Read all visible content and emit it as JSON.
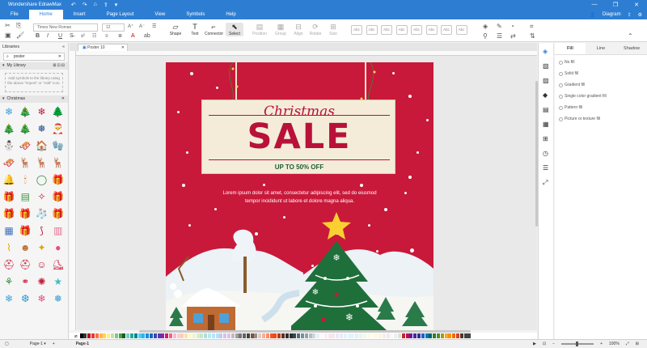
{
  "app": {
    "title": "Wondershare EdrawMax",
    "user_label": "Diagram",
    "window_controls": [
      "—",
      "❐",
      "✕"
    ]
  },
  "quick_access": [
    "↶",
    "↷",
    "⌂",
    "⇪",
    "▾"
  ],
  "tabs": [
    "File",
    "Home",
    "Insert",
    "Page Layout",
    "View",
    "Symbols",
    "Help"
  ],
  "active_tab": "Home",
  "ribbon": {
    "font_name": "Times New Roman",
    "font_size": "12",
    "tools": [
      {
        "label": "Shape",
        "icon": "▱",
        "state": "normal"
      },
      {
        "label": "Text",
        "icon": "T",
        "state": "normal"
      },
      {
        "label": "Connector",
        "icon": "⌐",
        "state": "normal"
      },
      {
        "label": "Select",
        "icon": "⬉",
        "state": "selected"
      },
      {
        "label": "Position",
        "icon": "▤",
        "state": "dim"
      },
      {
        "label": "Group",
        "icon": "▦",
        "state": "dim"
      },
      {
        "label": "Align",
        "icon": "⊟",
        "state": "dim"
      },
      {
        "label": "Rotate",
        "icon": "⟳",
        "state": "dim"
      },
      {
        "label": "Size",
        "icon": "⊞",
        "state": "dim"
      }
    ],
    "style_boxes": [
      "Abc",
      "Abc",
      "Abc",
      "Abc",
      "Abc",
      "Abc",
      "Abc",
      "Abc"
    ]
  },
  "library": {
    "title": "Libraries",
    "search_value": "poster",
    "my_library": "My Library",
    "add_hint": "Add symbols to the library using the above \"Import\" or \"Add\" icon.",
    "category": "Christmas"
  },
  "symbols": [
    {
      "name": "snowflake-blue",
      "glyph": "❄",
      "color": "#3ba0d8"
    },
    {
      "name": "tree-green",
      "glyph": "🎄",
      "color": "#2e8b3a"
    },
    {
      "name": "snowflake-red",
      "glyph": "❄",
      "color": "#c8193a"
    },
    {
      "name": "tree-dark",
      "glyph": "🌲",
      "color": "#1f6f4a"
    },
    {
      "name": "tree-teal",
      "glyph": "🎄",
      "color": "#2a9d8f"
    },
    {
      "name": "tree-lime",
      "glyph": "🎄",
      "color": "#3a9a3a"
    },
    {
      "name": "snowflake-navy",
      "glyph": "❅",
      "color": "#2f4f8f"
    },
    {
      "name": "santa",
      "glyph": "🎅",
      "color": "#c8193a"
    },
    {
      "name": "snowman",
      "glyph": "⛄",
      "color": "#555"
    },
    {
      "name": "sled",
      "glyph": "🛷",
      "color": "#c8193a"
    },
    {
      "name": "cabin",
      "glyph": "🏠",
      "color": "#b5651d"
    },
    {
      "name": "mitten",
      "glyph": "🧤",
      "color": "#3ba0d8"
    },
    {
      "name": "sleigh",
      "glyph": "🛷",
      "color": "#c8193a"
    },
    {
      "name": "reindeer-team",
      "glyph": "🦌",
      "color": "#a0522d"
    },
    {
      "name": "reindeer",
      "glyph": "🦌",
      "color": "#8b5a2b"
    },
    {
      "name": "deer",
      "glyph": "🦌",
      "color": "#a0522d"
    },
    {
      "name": "bells",
      "glyph": "🔔",
      "color": "#e0a800"
    },
    {
      "name": "candle",
      "glyph": "🕯",
      "color": "#e07020"
    },
    {
      "name": "wreath",
      "glyph": "◯",
      "color": "#2e8b3a"
    },
    {
      "name": "gift-stack",
      "glyph": "🎁",
      "color": "#d04040"
    },
    {
      "name": "gift-teal",
      "glyph": "🎁",
      "color": "#2a9d8f"
    },
    {
      "name": "card-green",
      "glyph": "▤",
      "color": "#3a9a3a"
    },
    {
      "name": "ornament",
      "glyph": "✧",
      "color": "#c8193a"
    },
    {
      "name": "gift-purple",
      "glyph": "🎁",
      "color": "#5b5bd6"
    },
    {
      "name": "gift-red",
      "glyph": "🎁",
      "color": "#c8193a"
    },
    {
      "name": "gift-blue",
      "glyph": "🎁",
      "color": "#3ba0d8"
    },
    {
      "name": "stocking",
      "glyph": "🧦",
      "color": "#c8193a"
    },
    {
      "name": "gift-pink",
      "glyph": "🎁",
      "color": "#e05080"
    },
    {
      "name": "pattern-blue",
      "glyph": "▦",
      "color": "#3b6fb8"
    },
    {
      "name": "gift-aqua",
      "glyph": "🎁",
      "color": "#3ac0c8"
    },
    {
      "name": "candy-cane",
      "glyph": "⟆",
      "color": "#c8193a"
    },
    {
      "name": "sweater",
      "glyph": "▥",
      "color": "#e07090"
    },
    {
      "name": "candy",
      "glyph": "⌇",
      "color": "#e0a800"
    },
    {
      "name": "gingerbread",
      "glyph": "☻",
      "color": "#c07030"
    },
    {
      "name": "ornament-gold",
      "glyph": "✦",
      "color": "#e0a800"
    },
    {
      "name": "bauble-pink",
      "glyph": "●",
      "color": "#e05080"
    },
    {
      "name": "santa-hat",
      "glyph": "⛑",
      "color": "#c8193a"
    },
    {
      "name": "hat-red",
      "glyph": "⛑",
      "color": "#c8193a"
    },
    {
      "name": "santa-face",
      "glyph": "☺",
      "color": "#c8193a"
    },
    {
      "name": "boots",
      "glyph": "⛸",
      "color": "#c8193a"
    },
    {
      "name": "antlers",
      "glyph": "⚘",
      "color": "#2e8b3a"
    },
    {
      "name": "bow",
      "glyph": "⚭",
      "color": "#c8193a"
    },
    {
      "name": "ornaments",
      "glyph": "✺",
      "color": "#c8193a"
    },
    {
      "name": "star",
      "glyph": "★",
      "color": "#3ac0c8"
    },
    {
      "name": "snowflake-1",
      "glyph": "❄",
      "color": "#3ba0d8"
    },
    {
      "name": "snowflake-2",
      "glyph": "❆",
      "color": "#3ba0d8"
    },
    {
      "name": "snowflake-3",
      "glyph": "❄",
      "color": "#e05080"
    },
    {
      "name": "snowflake-4",
      "glyph": "❅",
      "color": "#3ba0d8"
    }
  ],
  "document": {
    "tab_name": "Poster 10"
  },
  "poster": {
    "title_script": "Christmas",
    "title_main": "SALE",
    "subtitle": "UP TO 50% OFF",
    "body_line1": "Lorem ipsum dolor sit amet, consectetur adipiscing elit, sed do eiusmod",
    "body_line2": "tempor incididunt ut labore et dolore magna aliqua.",
    "bg_color": "#c8193a",
    "accent_color": "#b8123a",
    "sign_bg": "#f4ecd9"
  },
  "right_panel": {
    "tabs": [
      "Fill",
      "Line",
      "Shadow"
    ],
    "active_tab": "Fill",
    "fill_options": [
      "No fill",
      "Solid fill",
      "Gradient fill",
      "Single color gradient fill",
      "Pattern fill",
      "Picture or texture fill"
    ],
    "strip_icons": [
      "fill-icon",
      "style-icon",
      "image-icon",
      "layers-icon",
      "page-icon",
      "chart-icon",
      "table-icon",
      "history-icon",
      "list-icon",
      "expand-icon"
    ]
  },
  "palette": [
    "#000000",
    "#333333",
    "#c00000",
    "#e53935",
    "#ff7043",
    "#ffb74d",
    "#ffd54f",
    "#fff176",
    "#c5e1a5",
    "#81c784",
    "#43a047",
    "#1b5e20",
    "#80cbc4",
    "#26a69a",
    "#00838f",
    "#4dd0e1",
    "#29b6f6",
    "#1e88e5",
    "#1565c0",
    "#3949ab",
    "#5e35b1",
    "#8e24aa",
    "#d81b60",
    "#f06292",
    "#f8bbd0",
    "#ffcdd2",
    "#ffccbc",
    "#ffe0b2",
    "#fff9c4",
    "#f0f4c3",
    "#dcedc8",
    "#c8e6c9",
    "#b2dfdb",
    "#b2ebf2",
    "#b3e5fc",
    "#bbdefb",
    "#c5cae9",
    "#d1c4e9",
    "#e1bee7",
    "#bdbdbd",
    "#9e9e9e",
    "#757575",
    "#616161",
    "#424242",
    "#795548",
    "#a1887f",
    "#d7ccc8",
    "#ffab91",
    "#ff8a65",
    "#f4511e",
    "#e64a19",
    "#bf360c",
    "#4e342e",
    "#3e2723",
    "#263238",
    "#37474f",
    "#546e7a",
    "#78909c",
    "#90a4ae",
    "#b0bec5",
    "#cfd8dc",
    "#eceff1",
    "#fafafa",
    "#ffebee",
    "#fce4ec",
    "#f3e5f5",
    "#ede7f6",
    "#e8eaf6",
    "#e3f2fd",
    "#e1f5fe",
    "#e0f7fa",
    "#e0f2f1",
    "#e8f5e9",
    "#f1f8e9",
    "#f9fbe7",
    "#fffde7",
    "#fff8e1",
    "#fff3e0",
    "#fbe9e7",
    "#efebe9",
    "#fafafa",
    "#eceff1",
    "#e0e0e0",
    "#c62828",
    "#ad1457",
    "#6a1b9a",
    "#4527a0",
    "#283593",
    "#1565c0",
    "#0277bd",
    "#00695c",
    "#2e7d32",
    "#558b2f",
    "#9e9d24",
    "#f9a825",
    "#ff8f00",
    "#ef6c00",
    "#d84315",
    "#4e342e",
    "#424242",
    "#37474f"
  ],
  "status": {
    "page_selector": "Page-1",
    "page_tab": "Page-1",
    "zoom": "100%"
  }
}
